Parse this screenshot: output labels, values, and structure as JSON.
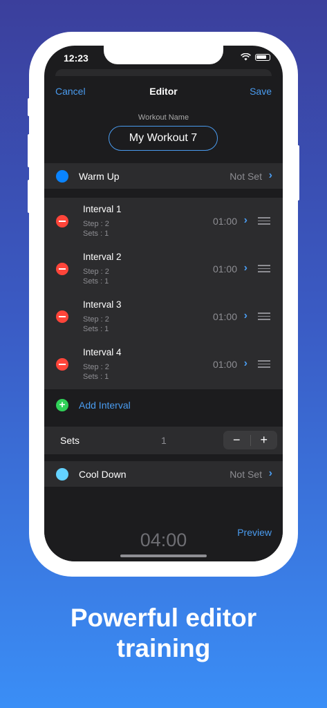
{
  "status_bar": {
    "time": "12:23"
  },
  "nav": {
    "cancel": "Cancel",
    "title": "Editor",
    "save": "Save"
  },
  "workout": {
    "name_label": "Workout Name",
    "name_value": "My Workout 7"
  },
  "warm_up": {
    "label": "Warm Up",
    "value": "Not Set",
    "color": "#0a84ff"
  },
  "intervals": [
    {
      "name": "Interval 1",
      "step": "Step : 2",
      "sets": "Sets : 1",
      "time": "01:00"
    },
    {
      "name": "Interval 2",
      "step": "Step : 2",
      "sets": "Sets : 1",
      "time": "01:00"
    },
    {
      "name": "Interval 3",
      "step": "Step : 2",
      "sets": "Sets : 1",
      "time": "01:00"
    },
    {
      "name": "Interval 4",
      "step": "Step : 2",
      "sets": "Sets : 1",
      "time": "01:00"
    }
  ],
  "add_interval": {
    "label": "Add Interval",
    "color": "#30d158"
  },
  "sets": {
    "label": "Sets",
    "value": "1",
    "minus": "−",
    "plus": "+"
  },
  "cool_down": {
    "label": "Cool Down",
    "value": "Not Set",
    "color": "#64d2ff"
  },
  "footer": {
    "total_time": "04:00",
    "preview": "Preview"
  },
  "tagline": {
    "line1": "Powerful editor",
    "line2": "training"
  },
  "colors": {
    "accent": "#4a9cf0",
    "delete": "#ff453a"
  }
}
